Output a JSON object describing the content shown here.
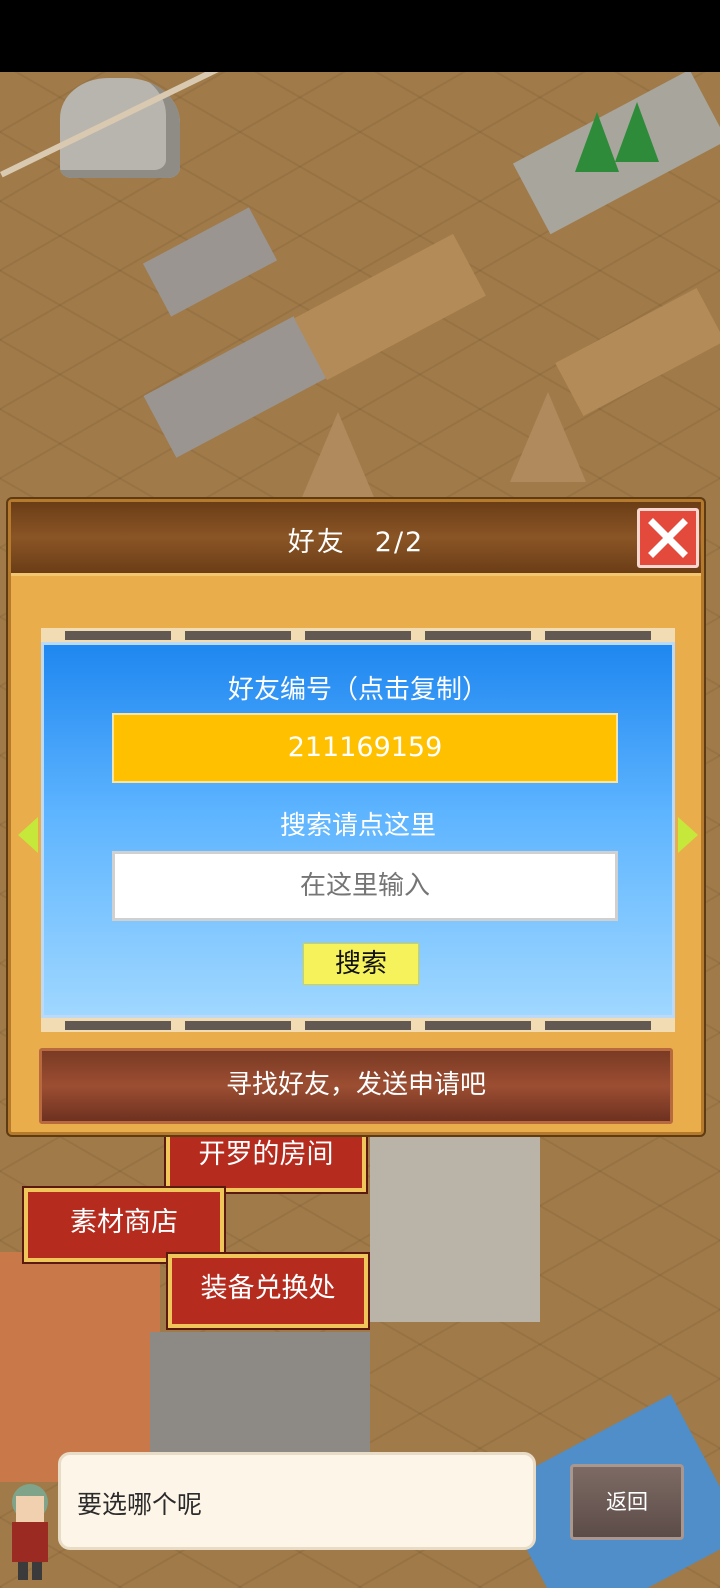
{
  "dialog": {
    "title": "好友　2/2",
    "friend_id_label": "好友编号（点击复制）",
    "friend_id": "211169159",
    "search_label": "搜索请点这里",
    "search_placeholder": "在这里输入",
    "search_button": "搜索",
    "send_request_label": "寻找好友，发送申请吧"
  },
  "map_labels": {
    "kairo_room": "开罗的房间",
    "material_shop": "素材商店",
    "equipment_exchange": "装备兑换处"
  },
  "message_bar": {
    "text": "要选哪个呢",
    "back_button": "返回"
  },
  "colors": {
    "dialog_bg": "#e9ad4c",
    "friend_id_bg": "#ffc000",
    "search_button_bg": "#f6f25c",
    "close_button_bg": "#e34a3c"
  },
  "icons": {
    "close": "close-icon",
    "left_arrow": "arrow-left-icon",
    "right_arrow": "arrow-right-icon"
  }
}
